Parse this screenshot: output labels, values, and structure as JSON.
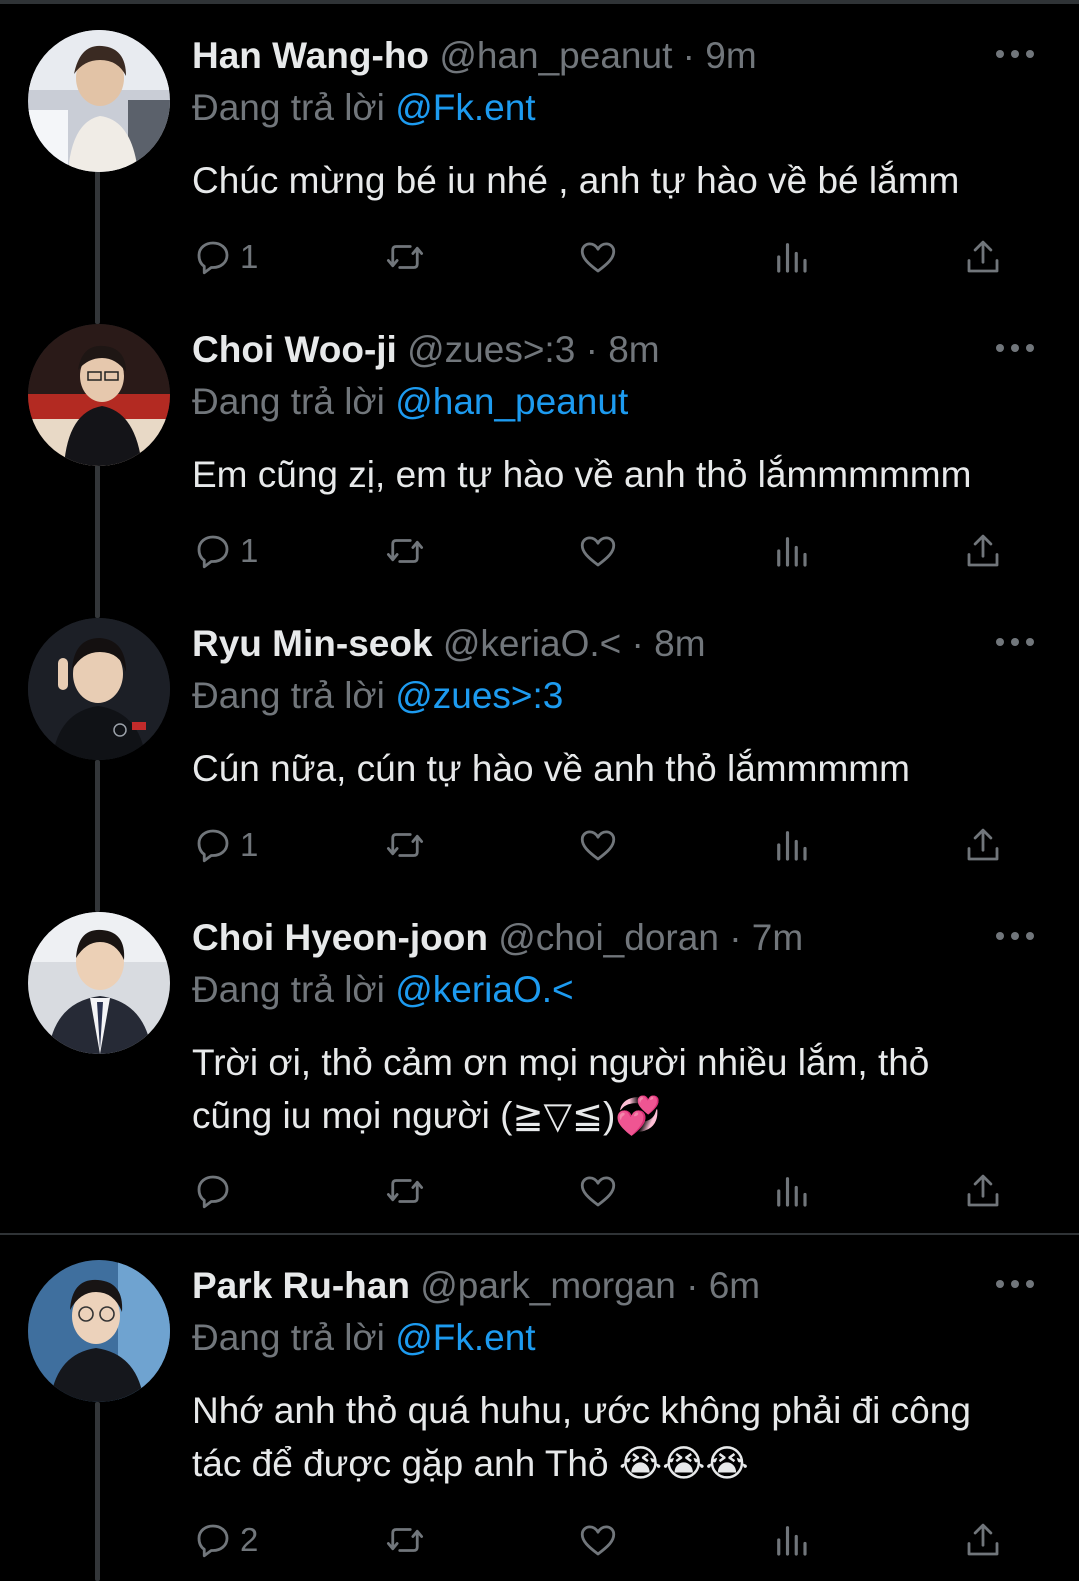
{
  "colors": {
    "background": "#000000",
    "text_primary": "#e7e9ea",
    "text_secondary": "#71767b",
    "accent": "#1d9bf0",
    "divider": "#2f3336"
  },
  "reply_prefix": "Đang trả lời",
  "icons": [
    "reply-icon",
    "retweet-icon",
    "like-icon",
    "views-icon",
    "share-icon",
    "more-icon"
  ],
  "tweets": [
    {
      "name": "Han Wang-ho",
      "handle": "@han_peanut",
      "separator": "·",
      "time": "9m",
      "reply_to": "@Fk.ent",
      "text": "Chúc mừng bé iu nhé , anh tự hào về bé lắmm",
      "reply_count": "1"
    },
    {
      "name": "Choi Woo-ji",
      "handle": "@zues>:3",
      "separator": "·",
      "time": "8m",
      "reply_to": "@han_peanut",
      "text": "Em cũng zị, em tự hào về anh thỏ lắmmmmmm",
      "reply_count": "1"
    },
    {
      "name": "Ryu Min-seok",
      "handle": "@keriaO.<",
      "separator": "·",
      "time": "8m",
      "reply_to": "@zues>:3",
      "text": "Cún nữa, cún tự hào về anh thỏ lắmmmmm",
      "reply_count": "1"
    },
    {
      "name": "Choi Hyeon-joon",
      "handle": "@choi_doran",
      "separator": "·",
      "time": "7m",
      "reply_to": "@keriaO.<",
      "text": "Trời ơi, thỏ cảm ơn mọi người nhiều lắm, thỏ\ncũng iu mọi người (≧▽≦)💞",
      "reply_count": ""
    },
    {
      "name": "Park Ru-han",
      "handle": "@park_morgan",
      "separator": "·",
      "time": "6m",
      "reply_to": "@Fk.ent",
      "text": "Nhớ anh thỏ quá huhu, ước không phải đi công\ntác để được gặp anh Thỏ 😭😭😭",
      "reply_count": "2"
    }
  ]
}
